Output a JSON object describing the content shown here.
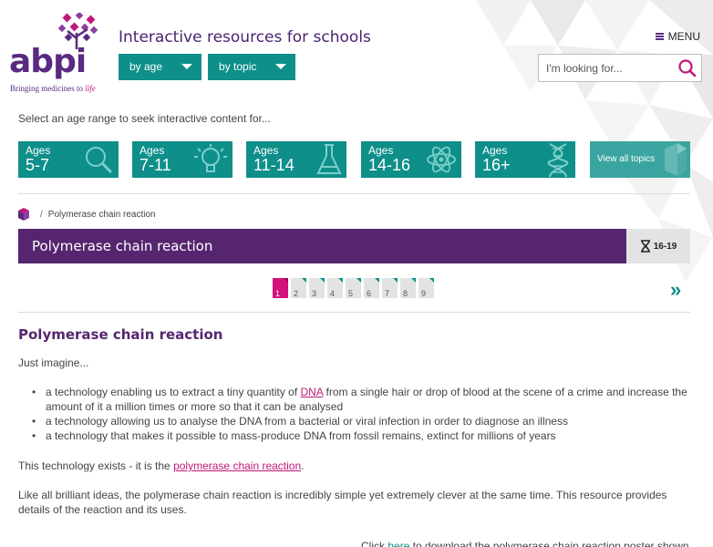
{
  "header": {
    "logo_text": "abpi",
    "logo_tagline_pre": "Bringing medicines to ",
    "logo_tagline_em": "life",
    "site_title": "Interactive resources for schools",
    "dropdown_age": "by age",
    "dropdown_topic": "by topic",
    "menu_label": "MENU",
    "search_placeholder": "I'm looking for..."
  },
  "age_prompt": "Select an age range to seek interactive content for...",
  "age_tiles": [
    {
      "small": "Ages",
      "big": "5-7",
      "icon": "magnifier-icon"
    },
    {
      "small": "Ages",
      "big": "7-11",
      "icon": "lightbulb-icon"
    },
    {
      "small": "Ages",
      "big": "11-14",
      "icon": "flask-icon"
    },
    {
      "small": "Ages",
      "big": "14-16",
      "icon": "atom-icon"
    },
    {
      "small": "Ages",
      "big": "16+",
      "icon": "dna-icon"
    }
  ],
  "view_all_label": "View all topics",
  "breadcrumb": {
    "sep": "/",
    "current": "Polymerase chain reaction"
  },
  "banner": {
    "title": "Polymerase chain reaction",
    "age_range": "16-19"
  },
  "pager": {
    "pages": [
      "1",
      "2",
      "3",
      "4",
      "5",
      "6",
      "7",
      "8",
      "9"
    ],
    "current": "1",
    "next": "»"
  },
  "article": {
    "heading": "Polymerase chain reaction",
    "intro": "Just imagine...",
    "bullet1_pre": "a technology enabling us to extract a tiny quantity of ",
    "bullet1_link": "DNA",
    "bullet1_post": " from a single hair or drop of blood at the scene of a crime and increase the amount of it a million times or more so that it can be analysed",
    "bullet2": "a technology allowing us to analyse the DNA from a bacterial or viral infection in order to diagnose an illness",
    "bullet3": "a technology that makes it possible to mass-produce DNA from fossil remains, extinct for millions of years",
    "p1_pre": "This technology exists - it is the ",
    "p1_link": "polymerase chain reaction",
    "p1_post": ".",
    "p2": "Like all brilliant ideas, the polymerase chain reaction is incredibly simple yet extremely clever at the same time. This resource provides details of the reaction and its uses.",
    "p3_pre": "Click ",
    "p3_link": "here",
    "p3_post": " to download the polymerase chain reaction poster shown"
  },
  "colors": {
    "teal": "#0e8f8a",
    "purple": "#55266f",
    "pink": "#c0187a",
    "page_active": "#d4127c"
  }
}
